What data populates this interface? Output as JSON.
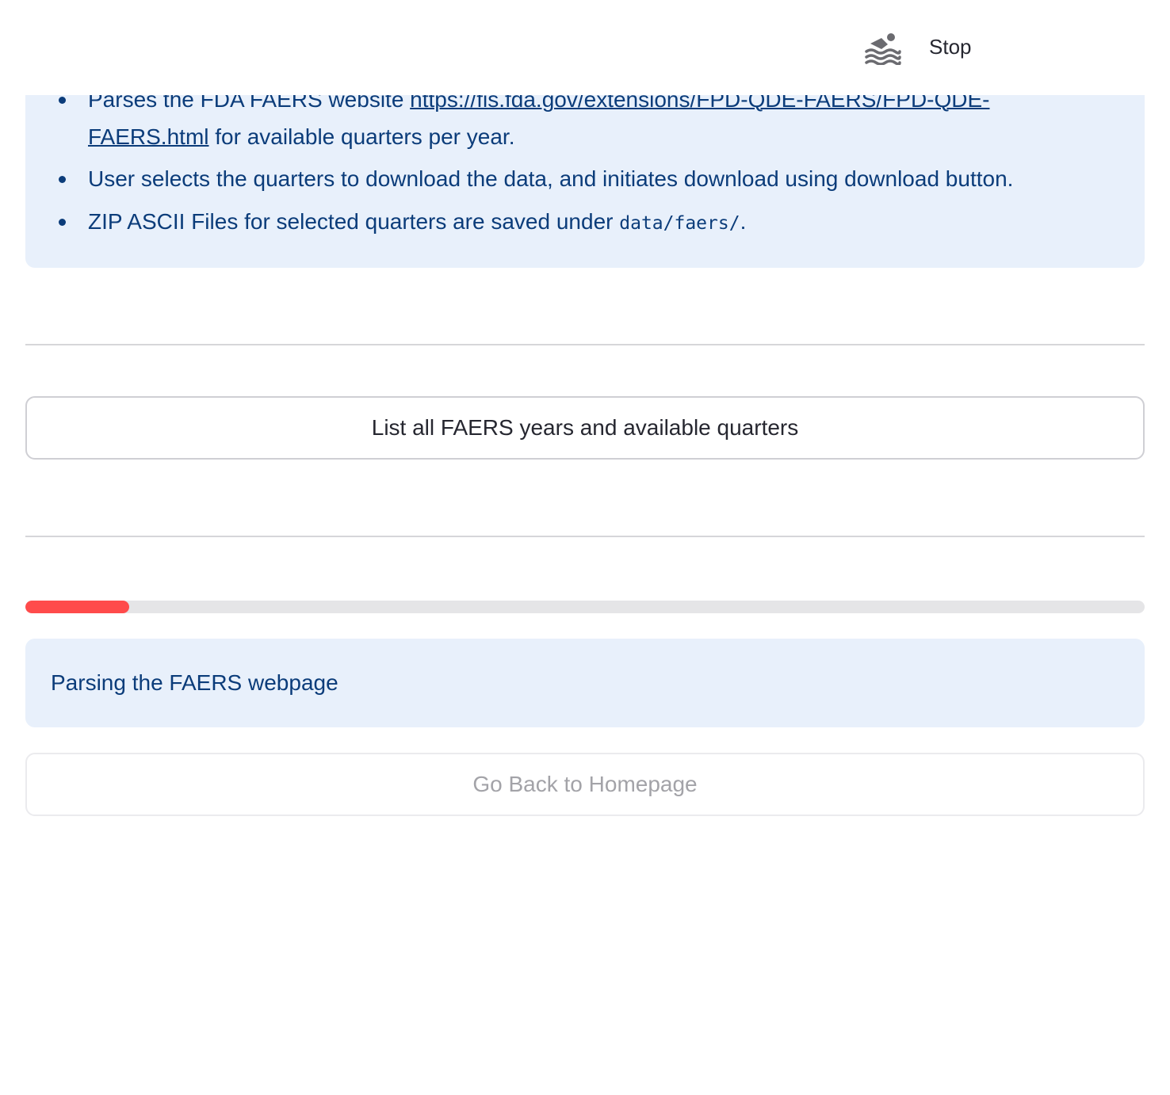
{
  "header": {
    "running_icon": "swimmer-icon",
    "stop_label": "Stop"
  },
  "info": {
    "bullet1": {
      "prefix": "Parses the FDA FAERS website ",
      "link_text": "https://fis.fda.gov/extensions/FPD-QDE-FAERS/FPD-QDE-FAERS.html",
      "suffix": " for available quarters per year."
    },
    "bullet2": "User selects the quarters to download the data, and initiates download using download button.",
    "bullet3": {
      "prefix": "ZIP ASCII Files for selected quarters are saved under ",
      "code": "data/faers/",
      "suffix": "."
    }
  },
  "list_button_label": "List all FAERS years and available quarters",
  "progress": {
    "value_percent": 9.3,
    "color": "#ff4b4b"
  },
  "status_message": "Parsing the FAERS webpage",
  "home_button_label": "Go Back to Homepage",
  "colors": {
    "info_background": "#e8f0fb",
    "info_text": "#0b3c7a",
    "accent": "#ff4b4b"
  }
}
